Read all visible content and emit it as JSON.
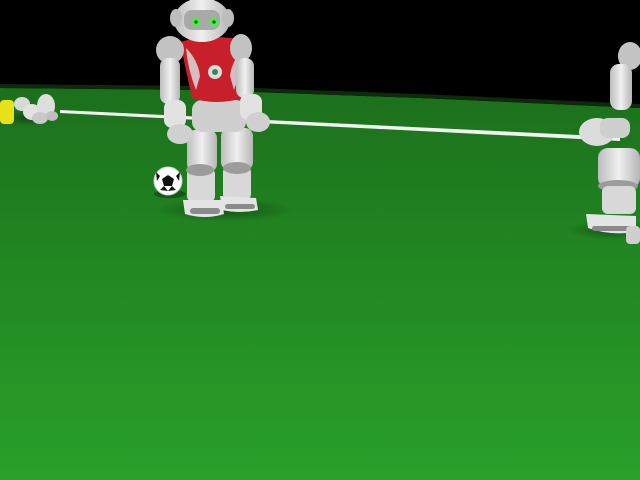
{
  "scene": {
    "colors": {
      "background": "#000000",
      "field_far": "#1f7a1f",
      "field_near": "#2a9a2a",
      "field_line": "#f2f2f2",
      "robot_body": "#e6e6e6",
      "robot_shade": "#a8a8a8",
      "robot_jersey": "#c8202a",
      "robot_eye": "#33ff33",
      "ball_white": "#ffffff",
      "ball_black": "#111111",
      "fallen_robot_jersey": "#e8e018"
    }
  }
}
